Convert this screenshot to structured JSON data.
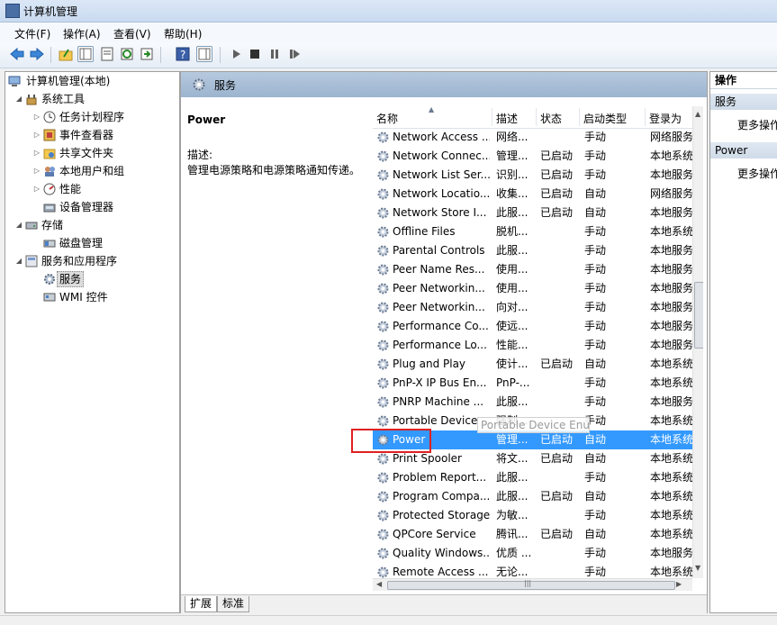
{
  "window": {
    "title": "计算机管理"
  },
  "menu": [
    "文件(F)",
    "操作(A)",
    "查看(V)",
    "帮助(H)"
  ],
  "tree": {
    "root": "计算机管理(本地)",
    "system_tools": "系统工具",
    "task_scheduler": "任务计划程序",
    "event_viewer": "事件查看器",
    "shared_folders": "共享文件夹",
    "local_users": "本地用户和组",
    "performance": "性能",
    "device_manager": "设备管理器",
    "storage": "存储",
    "disk_management": "磁盘管理",
    "services_apps": "服务和应用程序",
    "services": "服务",
    "wmi": "WMI 控件"
  },
  "center": {
    "header_title": "服务",
    "detail_title": "Power",
    "desc_label": "描述:",
    "desc_text": "管理电源策略和电源策略通知传递。"
  },
  "columns": [
    "名称",
    "描述",
    "状态",
    "启动类型",
    "登录为"
  ],
  "services": [
    {
      "name": "Network Access ...",
      "desc": "网络...",
      "status": "",
      "type": "手动",
      "logon": "网络服务"
    },
    {
      "name": "Network Connec...",
      "desc": "管理...",
      "status": "已启动",
      "type": "手动",
      "logon": "本地系统"
    },
    {
      "name": "Network List Ser...",
      "desc": "识别...",
      "status": "已启动",
      "type": "手动",
      "logon": "本地服务"
    },
    {
      "name": "Network Locatio...",
      "desc": "收集...",
      "status": "已启动",
      "type": "自动",
      "logon": "网络服务"
    },
    {
      "name": "Network Store I...",
      "desc": "此服...",
      "status": "已启动",
      "type": "自动",
      "logon": "本地服务"
    },
    {
      "name": "Offline Files",
      "desc": "脱机...",
      "status": "",
      "type": "手动",
      "logon": "本地系统"
    },
    {
      "name": "Parental Controls",
      "desc": "此服...",
      "status": "",
      "type": "手动",
      "logon": "本地服务"
    },
    {
      "name": "Peer Name Res...",
      "desc": "使用...",
      "status": "",
      "type": "手动",
      "logon": "本地服务"
    },
    {
      "name": "Peer Networkin...",
      "desc": "使用...",
      "status": "",
      "type": "手动",
      "logon": "本地服务"
    },
    {
      "name": "Peer Networkin...",
      "desc": "向对...",
      "status": "",
      "type": "手动",
      "logon": "本地服务"
    },
    {
      "name": "Performance Co...",
      "desc": "使远...",
      "status": "",
      "type": "手动",
      "logon": "本地服务"
    },
    {
      "name": "Performance Lo...",
      "desc": "性能...",
      "status": "",
      "type": "手动",
      "logon": "本地服务"
    },
    {
      "name": "Plug and Play",
      "desc": "使计...",
      "status": "已启动",
      "type": "自动",
      "logon": "本地系统"
    },
    {
      "name": "PnP-X IP Bus En...",
      "desc": "PnP-...",
      "status": "",
      "type": "手动",
      "logon": "本地系统"
    },
    {
      "name": "PNRP Machine ...",
      "desc": "此服...",
      "status": "",
      "type": "手动",
      "logon": "本地服务"
    },
    {
      "name": "Portable Device ...",
      "desc": "强制...",
      "status": "",
      "type": "手动",
      "logon": "本地系统"
    },
    {
      "name": "Power",
      "desc": "管理...",
      "status": "已启动",
      "type": "自动",
      "logon": "本地系统"
    },
    {
      "name": "Print Spooler",
      "desc": "将文...",
      "status": "已启动",
      "type": "自动",
      "logon": "本地系统"
    },
    {
      "name": "Problem Report...",
      "desc": "此服...",
      "status": "",
      "type": "手动",
      "logon": "本地系统"
    },
    {
      "name": "Program Compa...",
      "desc": "此服...",
      "status": "已启动",
      "type": "自动",
      "logon": "本地系统"
    },
    {
      "name": "Protected Storage",
      "desc": "为敏...",
      "status": "",
      "type": "手动",
      "logon": "本地系统"
    },
    {
      "name": "QPCore Service",
      "desc": "腾讯...",
      "status": "已启动",
      "type": "自动",
      "logon": "本地系统"
    },
    {
      "name": "Quality Windows...",
      "desc": "优质 ...",
      "status": "",
      "type": "手动",
      "logon": "本地服务"
    },
    {
      "name": "Remote Access ...",
      "desc": "无论...",
      "status": "",
      "type": "手动",
      "logon": "本地系统"
    }
  ],
  "tooltip": "Portable Device Enumerator Service",
  "tabs": [
    "扩展",
    "标准"
  ],
  "actions": {
    "header": "操作",
    "section1": "服务",
    "section1_more": "更多操作",
    "section2": "Power",
    "section2_more": "更多操作"
  },
  "colors": {
    "selection": "#3399ff",
    "highlight_box": "#e02020",
    "header_band": "#9cb4cf"
  }
}
